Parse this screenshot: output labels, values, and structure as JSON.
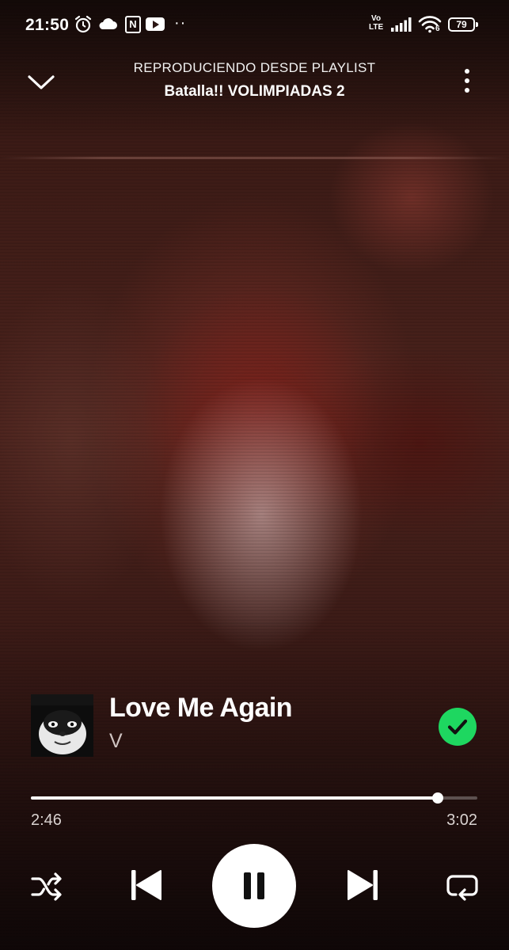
{
  "status_bar": {
    "time": "21:50",
    "notion_letter": "N",
    "overflow": "··",
    "network": [
      "Vo",
      "LTE"
    ],
    "wifi_label": "6",
    "battery": "79",
    "icons": [
      "alarm-icon",
      "cloud-icon",
      "notion-icon",
      "youtube-icon",
      "volte-icon",
      "signal-icon",
      "wifi-icon",
      "battery-icon"
    ]
  },
  "header": {
    "context_label": "REPRODUCIENDO DESDE PLAYLIST",
    "playlist_name": "Batalla!! VOLIMPIADAS 2",
    "icons": [
      "chevron-down-icon",
      "more-vertical-icon"
    ]
  },
  "track": {
    "title": "Love Me Again",
    "artist": "V",
    "liked": true,
    "icons": [
      "album-cover",
      "check-circle-icon"
    ]
  },
  "playback": {
    "elapsed": "2:46",
    "duration": "3:02",
    "progress_fraction": 0.912
  },
  "controls": {
    "icons": [
      "shuffle-icon",
      "skip-previous-icon",
      "pause-icon",
      "skip-next-icon",
      "repeat-icon"
    ]
  },
  "colors": {
    "accent_green": "#1ed760",
    "text_primary": "#ffffff",
    "text_secondary": "#cfc4c2"
  }
}
